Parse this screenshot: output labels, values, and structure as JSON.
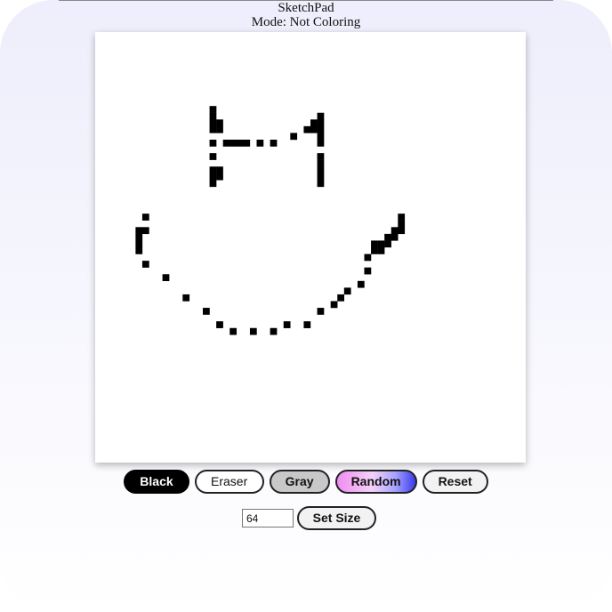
{
  "app": {
    "title": "SketchPad",
    "mode_text": "Mode: Not Coloring"
  },
  "buttons": {
    "black": "Black",
    "eraser": "Eraser",
    "gray": "Gray",
    "random": "Random",
    "reset": "Reset",
    "set_size": "Set Size"
  },
  "grid": {
    "size_value": "64",
    "colors": {
      "ink": "#000000",
      "background": "#ffffff"
    },
    "filled_cells": [
      [
        17,
        11
      ],
      [
        17,
        12
      ],
      [
        17,
        13
      ],
      [
        18,
        13
      ],
      [
        17,
        14
      ],
      [
        18,
        14
      ],
      [
        17,
        16
      ],
      [
        17,
        18
      ],
      [
        17,
        20
      ],
      [
        18,
        20
      ],
      [
        17,
        21
      ],
      [
        18,
        21
      ],
      [
        17,
        22
      ],
      [
        19,
        16
      ],
      [
        20,
        16
      ],
      [
        21,
        16
      ],
      [
        22,
        16
      ],
      [
        24,
        16
      ],
      [
        26,
        16
      ],
      [
        29,
        15
      ],
      [
        31,
        14
      ],
      [
        32,
        14
      ],
      [
        32,
        13
      ],
      [
        33,
        12
      ],
      [
        33,
        13
      ],
      [
        33,
        14
      ],
      [
        33,
        15
      ],
      [
        33,
        16
      ],
      [
        33,
        18
      ],
      [
        33,
        19
      ],
      [
        33,
        20
      ],
      [
        33,
        21
      ],
      [
        33,
        22
      ],
      [
        7,
        27
      ],
      [
        6,
        29
      ],
      [
        7,
        29
      ],
      [
        6,
        30
      ],
      [
        6,
        31
      ],
      [
        6,
        32
      ],
      [
        7,
        34
      ],
      [
        10,
        36
      ],
      [
        13,
        39
      ],
      [
        16,
        41
      ],
      [
        18,
        43
      ],
      [
        20,
        44
      ],
      [
        23,
        44
      ],
      [
        26,
        44
      ],
      [
        28,
        43
      ],
      [
        31,
        43
      ],
      [
        33,
        41
      ],
      [
        35,
        40
      ],
      [
        36,
        39
      ],
      [
        37,
        38
      ],
      [
        39,
        37
      ],
      [
        40,
        35
      ],
      [
        40,
        33
      ],
      [
        41,
        32
      ],
      [
        42,
        32
      ],
      [
        41,
        31
      ],
      [
        42,
        31
      ],
      [
        43,
        31
      ],
      [
        43,
        30
      ],
      [
        44,
        30
      ],
      [
        44,
        29
      ],
      [
        45,
        29
      ],
      [
        45,
        28
      ],
      [
        45,
        27
      ]
    ]
  }
}
